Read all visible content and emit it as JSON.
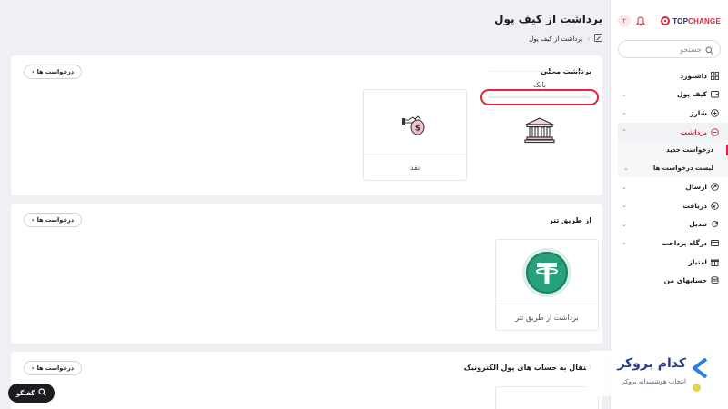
{
  "brand": {
    "name_main": "TOP",
    "name_accent": "CHANGE",
    "notification_count": "۲"
  },
  "search": {
    "placeholder": "جستجو"
  },
  "sidebar": {
    "items": [
      {
        "label": "داشبورد"
      },
      {
        "label": "کیف پول"
      },
      {
        "label": "شارژ"
      },
      {
        "label": "برداشت"
      },
      {
        "label": "ارسال"
      },
      {
        "label": "دریافت"
      },
      {
        "label": "تبدیل"
      },
      {
        "label": "درگاه پرداخت"
      },
      {
        "label": "امتیاز"
      },
      {
        "label": "حسابهای من"
      }
    ],
    "submenu": [
      {
        "label": "درخواست جدید"
      },
      {
        "label": "لیست درخواست ها"
      }
    ]
  },
  "page": {
    "title": "برداشت از کیف پول",
    "breadcrumb": "برداشت از کیف پول"
  },
  "sections": [
    {
      "title": "برداشت محلی",
      "button": "درخواست ها",
      "options": [
        {
          "label": "بانک",
          "icon": "bank-icon"
        },
        {
          "label": "نقد",
          "icon": "cash-hand-icon"
        }
      ]
    },
    {
      "title": "از طریق تتر",
      "button": "درخواست ها",
      "options": [
        {
          "label": "برداشت از طریق تتر",
          "icon": "tether-icon"
        }
      ]
    },
    {
      "title": "انتقال به حساب های پول الکترونیک",
      "button": "درخواست ها"
    }
  ],
  "chat": {
    "label": "گفتگو"
  },
  "watermark": {
    "title": "کدام بروکر",
    "subtitle": "انتخاب هوشمندانه بروکر"
  },
  "colors": {
    "accent": "#e0263c",
    "brand_navy": "#1f2a6b",
    "tether_green": "#26a17b"
  }
}
